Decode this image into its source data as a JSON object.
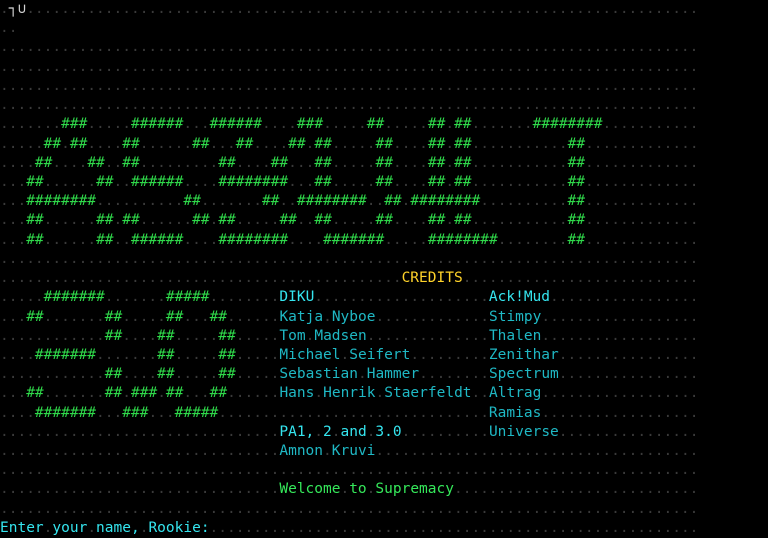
{
  "terminal": {
    "columns": 80,
    "rows": 28,
    "background_color": "#000000",
    "filler_char": ".",
    "filler_color": "#3a3a3a",
    "cursor_glyph": "┐∪"
  },
  "colors": {
    "dot": "#3a3a3a",
    "bright_green": "#2fd94a",
    "yellow": "#ffd32a",
    "cyan": "#1fb8c4",
    "bright_cyan": "#35e5ef",
    "white": "#d4d4d4"
  },
  "screen": {
    "corner_glyph": "┐∪",
    "banner_top": [
      "..........###.....######..######....###....##.....##.##......########.........",
      "........##.##...##....##.##...##.##....##.##.....##.##......##..............",
      "........##...##...##....##.......##.......##.....##.##......##..............",
      ".......##....##..######..######..##......##.##...##.##......##..............",
      ".......#########....##........##.##......##.##...##.##......##..............",
      ".......##....##...##.##....##.##.##......##.##...##.##......##..............",
      ".......##....##..######...######.##......##..#######....##..................."
    ],
    "banner_rows": [
      {
        "text": "......###....######..######....###....##.....##.##......########",
        "indent": 7
      },
      {
        "text": "....##.##..##....##..##....##..##.##..##.##.##.......##",
        "indent": 4
      }
    ],
    "banner_art": [
      "........###......######...######.....###.....##......##.##.........########.........",
      "......##.##....##.....##.##....##...##.##....##....##.##.##........##...............",
      ".....##...##...##.........##........##...##..##....##.##..........##................",
      "....##.....##..######.....######....##....##.##....##.##..........##................",
      "....#########......##.........##....##....##.##....##.##..........##................"
    ],
    "credits_header": "CREDITS",
    "credits": [
      {
        "left": "DIKU",
        "right": "Ack!Mud",
        "left_bold": true,
        "right_bold": true
      },
      {
        "left": "Katja Nyboe",
        "right": "Stimpy",
        "left_bold": false,
        "right_bold": false
      },
      {
        "left": "Tom Madsen",
        "right": "Thalen",
        "left_bold": false,
        "right_bold": false
      },
      {
        "left": "Michael Seifert",
        "right": "Zenithar",
        "left_bold": false,
        "right_bold": false
      },
      {
        "left": "Sebastian Hammer",
        "right": "Spectrum",
        "left_bold": false,
        "right_bold": false
      },
      {
        "left": "Hans Henrik Staerfeldt",
        "right": "Altrag",
        "left_bold": false,
        "right_bold": false
      },
      {
        "left": "",
        "right": "Ramias",
        "left_bold": false,
        "right_bold": false
      },
      {
        "left": "PA1, 2 and 3.0",
        "right": "Universe",
        "left_bold": true,
        "right_bold": false
      },
      {
        "left": "Amnon Kruvi",
        "right": "",
        "left_bold": false,
        "right_bold": false
      }
    ],
    "welcome_line": "Welcome to Supremacy",
    "prompt": "Enter your name, Rookie:"
  },
  "art": {
    "top_lines": [
      "       ###     ######  ######    ###    ##     ## ##       ########",
      "     ## ##    ##    ## ##    ##  ##     ## ##  ## ##             ##",
      "    ##   ##   ##       ##        ##     ##  ## ## ##            ##",
      "   ##     ##  ######   ######    ##     ##   #### ##           ##",
      "   #########       ##       ##   ##     ##    ### ##          ##"
    ],
    "bottom_lines": [
      "   #######     #####    ",
      "  ##      ##     ##   ##",
      "          ##   ##       ",
      "   #######     ##     ##",
      "          ##   ##     ##",
      "  ##      ##  ### ##  ##",
      "   ####### ###   #####  "
    ]
  }
}
